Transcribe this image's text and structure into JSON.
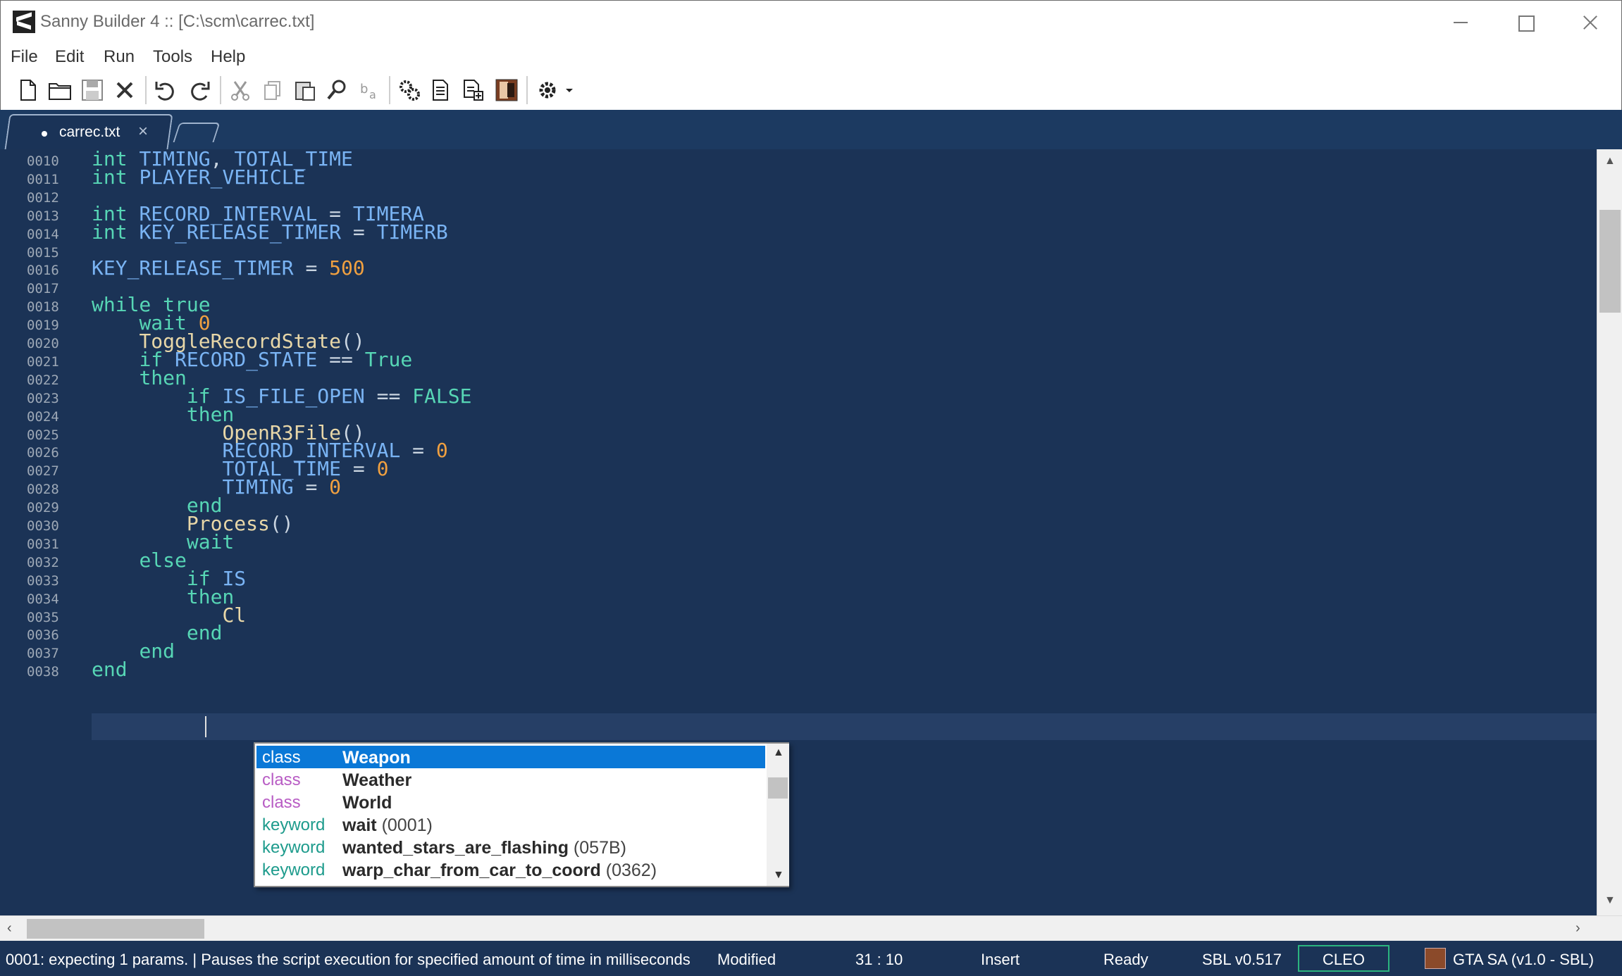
{
  "window": {
    "title": "Sanny Builder 4 :: [C:\\scm\\carrec.txt]"
  },
  "menu": [
    "File",
    "Edit",
    "Run",
    "Tools",
    "Help"
  ],
  "tabs": [
    {
      "label": "carrec.txt",
      "modified": true
    }
  ],
  "editor": {
    "lines": [
      {
        "no": "0010",
        "text": "int TIMING, TOTAL_TIME"
      },
      {
        "no": "0011",
        "text": "int PLAYER_VEHICLE"
      },
      {
        "no": "0012",
        "text": ""
      },
      {
        "no": "0013",
        "text": "int RECORD_INTERVAL = TIMERA"
      },
      {
        "no": "0014",
        "text": "int KEY_RELEASE_TIMER = TIMERB"
      },
      {
        "no": "0015",
        "text": ""
      },
      {
        "no": "0016",
        "text": "KEY_RELEASE_TIMER = 500"
      },
      {
        "no": "0017",
        "text": ""
      },
      {
        "no": "0018",
        "text": "while true"
      },
      {
        "no": "0019",
        "text": "    wait 0"
      },
      {
        "no": "0020",
        "text": "    ToggleRecordState()"
      },
      {
        "no": "0021",
        "text": "    if RECORD_STATE == True"
      },
      {
        "no": "0022",
        "text": "    then"
      },
      {
        "no": "0023",
        "text": "        if IS_FILE_OPEN == FALSE"
      },
      {
        "no": "0024",
        "text": "        then"
      },
      {
        "no": "0025",
        "text": "           OpenR3File()"
      },
      {
        "no": "0026",
        "text": "           RECORD_INTERVAL = 0"
      },
      {
        "no": "0027",
        "text": "           TOTAL_TIME = 0"
      },
      {
        "no": "0028",
        "text": "           TIMING = 0"
      },
      {
        "no": "0029",
        "text": "        end"
      },
      {
        "no": "0030",
        "text": "        Process()"
      },
      {
        "no": "0031",
        "text": "        wait"
      },
      {
        "no": "0032",
        "text": "    else"
      },
      {
        "no": "0033",
        "text": "        if IS"
      },
      {
        "no": "0034",
        "text": "        then"
      },
      {
        "no": "0035",
        "text": "           Cl"
      },
      {
        "no": "0036",
        "text": "        end"
      },
      {
        "no": "0037",
        "text": "    end"
      },
      {
        "no": "0038",
        "text": "end"
      }
    ]
  },
  "autocomplete": [
    {
      "kind": "class",
      "name": "Weapon",
      "code": "",
      "selected": true
    },
    {
      "kind": "class",
      "name": "Weather",
      "code": ""
    },
    {
      "kind": "class",
      "name": "World",
      "code": ""
    },
    {
      "kind": "keyword",
      "name": "wait",
      "code": "(0001)"
    },
    {
      "kind": "keyword",
      "name": "wanted_stars_are_flashing",
      "code": "(057B)"
    },
    {
      "kind": "keyword",
      "name": "warp_char_from_car_to_coord",
      "code": "(0362)"
    }
  ],
  "status": {
    "hint": "0001: expecting 1 params. | Pauses the script execution for specified amount of time in milliseconds",
    "modified": "Modified",
    "position": "31 : 10",
    "mode": "Insert",
    "state": "Ready",
    "sbl": "SBL v0.517",
    "cleo": "CLEO",
    "game": "GTA SA (v1.0 - SBL)"
  },
  "colors": {
    "editor_bg": "#1b3356",
    "keyword": "#57d6b5",
    "identifier": "#7ab4f4",
    "number": "#f0a040",
    "function": "#e8d7a8",
    "selection": "#0a78d7",
    "cleo_border": "#2bb57f"
  },
  "icons": [
    "new-file-icon",
    "open-folder-icon",
    "save-icon",
    "close-file-icon",
    "undo-icon",
    "redo-icon",
    "cut-icon",
    "copy-icon",
    "paste-icon",
    "find-icon",
    "replace-icon",
    "compile-icon",
    "compile-run-icon",
    "decompile-icon",
    "game-icon",
    "settings-icon"
  ]
}
